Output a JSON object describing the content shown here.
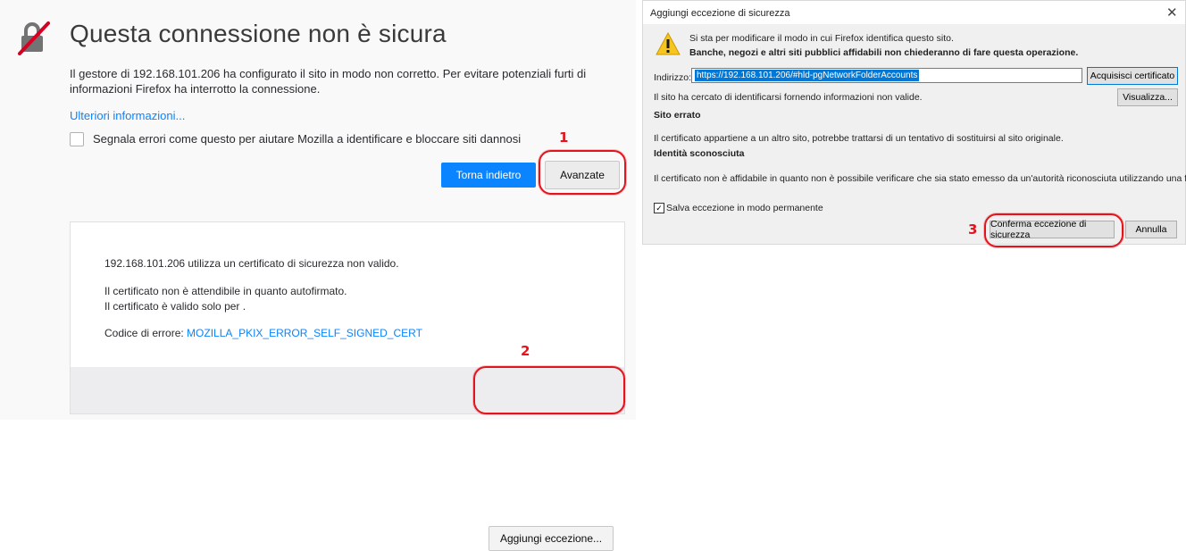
{
  "error_page": {
    "title": "Questa connessione non è sicura",
    "description": "Il gestore di 192.168.101.206 ha configurato il sito in modo non corretto. Per evitare potenziali furti di informazioni Firefox ha interrotto la connessione.",
    "learn_more": "Ulteriori informazioni...",
    "report_label": "Segnala errori come questo per aiutare Mozilla a identificare e bloccare siti dannosi",
    "report_checked": false,
    "back_button": "Torna indietro",
    "advanced_button": "Avanzate",
    "details": {
      "line1": "192.168.101.206 utilizza un certificato di sicurezza non valido.",
      "line2": "Il certificato non è attendibile in quanto autofirmato.",
      "line3": "Il certificato è valido solo per .",
      "error_label": "Codice di errore: ",
      "error_code": "MOZILLA_PKIX_ERROR_SELF_SIGNED_CERT",
      "add_exception_button": "Aggiungi eccezione..."
    }
  },
  "dialog": {
    "title": "Aggiungi eccezione di sicurezza",
    "warning_line1": "Si sta per modificare il modo in cui Firefox identifica questo sito.",
    "warning_line2": "Banche, negozi e altri siti pubblici affidabili non chiederanno di fare questa operazione.",
    "address_label": "Indirizzo:",
    "address_value": "https://192.168.101.206/#hld-pgNetworkFolderAccounts",
    "get_cert_button": "Acquisisci certificato",
    "identity_message": "Il sito ha cercato di identificarsi fornendo informazioni non valide.",
    "view_button": "Visualizza...",
    "wrong_site_heading": "Sito errato",
    "wrong_site_message": "Il certificato appartiene a un altro sito, potrebbe trattarsi di un tentativo di sostituirsi al sito originale.",
    "unknown_identity_heading": "Identità sconosciuta",
    "untrusted_message": "Il certificato non è affidabile in quanto non è possibile verificare che sia stato emesso da un'autorità riconosciuta utilizzando una firma sicura.",
    "permanent_label": "Salva eccezione in modo permanente",
    "permanent_checked": true,
    "confirm_button": "Conferma eccezione di sicurezza",
    "cancel_button": "Annulla"
  },
  "annotations": {
    "step1": "1",
    "step2": "2",
    "step3": "3",
    "color": "#e3141b"
  },
  "colors": {
    "accent_blue": "#0a84ff",
    "page_bg": "#f9f9fa",
    "dialog_bg": "#f0f0f0",
    "warning_yellow": "#f7c520"
  },
  "icons": {
    "lock": "broken-lock-icon",
    "warning": "warning-triangle-icon",
    "close": "close-icon"
  }
}
